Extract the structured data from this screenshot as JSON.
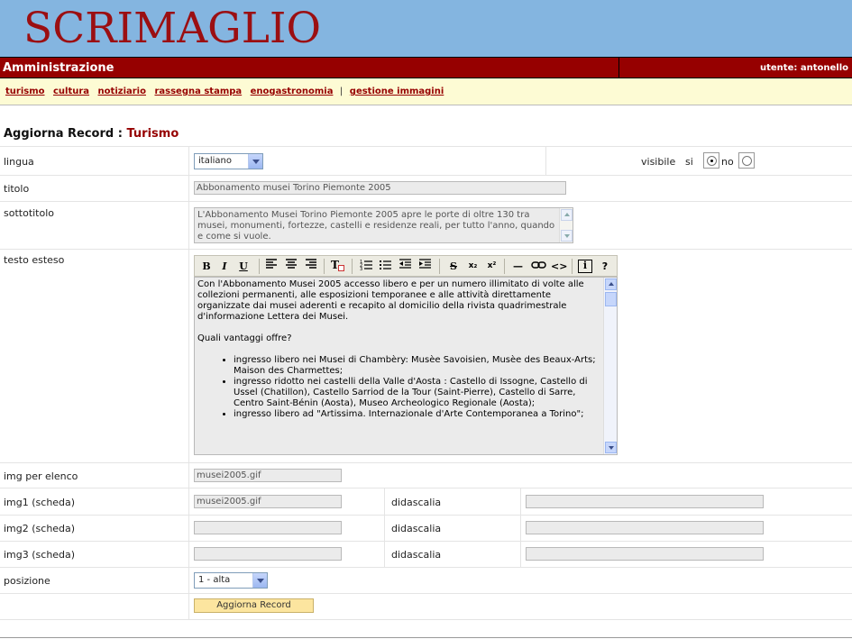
{
  "header": {
    "logo_text": "SCRIMAGLIO",
    "admin_title": "Amministrazione",
    "user_label": "utente: antonello"
  },
  "nav": {
    "links": [
      "turismo",
      "cultura",
      "notiziario",
      "rassegna stampa",
      "enogastronomia"
    ],
    "separator": "|",
    "extra_link": "gestione immagini"
  },
  "page": {
    "heading_prefix": "Aggiorna Record :",
    "heading_section": "Turismo"
  },
  "form": {
    "lingua": {
      "label": "lingua",
      "value": "italiano"
    },
    "visibile": {
      "label": "visibile",
      "option_si": "si",
      "option_no": "no",
      "selected": "si"
    },
    "titolo": {
      "label": "titolo",
      "value": "Abbonamento musei Torino Piemonte 2005"
    },
    "sottotitolo": {
      "label": "sottotitolo",
      "value": "L'Abbonamento Musei Torino Piemonte 2005 apre le porte di oltre 130 tra musei, monumenti, fortezze, castelli e residenze reali, per tutto l'anno, quando e come si vuole."
    },
    "testo_esteso": {
      "label": "testo esteso",
      "toolbar": {
        "bold": "B",
        "italic": "I",
        "underline": "U",
        "align_left": "align-left-icon",
        "align_center": "align-center-icon",
        "align_right": "align-right-icon",
        "clear_format": "clear-format-icon",
        "ordered_list": "ordered-list-icon",
        "unordered_list": "unordered-list-icon",
        "outdent": "outdent-icon",
        "indent": "indent-icon",
        "strike": "S",
        "subscript": "x₂",
        "superscript": "x²",
        "hr": "—",
        "link": "link-icon",
        "code": "<>",
        "info": "i",
        "help": "?"
      },
      "paragraph1": "Con l'Abbonamento Musei 2005 accesso libero e per un numero illimitato di volte alle collezioni permanenti, alle esposizioni temporanee e alle attività direttamente organizzate dai musei aderenti e recapito al domicilio della rivista quadrimestrale d'informazione Lettera dei Musei.",
      "paragraph2": "Quali vantaggi offre?",
      "bullets": [
        "ingresso libero nei Musei di Chambèry: Musèe Savoisien, Musèe des Beaux-Arts; Maison des Charmettes;",
        "ingresso ridotto nei castelli della Valle d'Aosta : Castello di Issogne, Castello di Ussel (Chatillon), Castello Sarriod de la Tour (Saint-Pierre), Castello di Sarre, Centro Saint-Bénin (Aosta), Museo Archeologico Regionale (Aosta);",
        "ingresso libero ad \"Artissima. Internazionale d'Arte Contemporanea a Torino\";"
      ]
    },
    "img_elenco": {
      "label": "img per elenco",
      "value": "musei2005.gif"
    },
    "img1": {
      "label": "img1 (scheda)",
      "value": "musei2005.gif",
      "didascalia_label": "didascalia",
      "didascalia_value": ""
    },
    "img2": {
      "label": "img2 (scheda)",
      "value": "",
      "didascalia_label": "didascalia",
      "didascalia_value": ""
    },
    "img3": {
      "label": "img3 (scheda)",
      "value": "",
      "didascalia_label": "didascalia",
      "didascalia_value": ""
    },
    "posizione": {
      "label": "posizione",
      "value": "1 - alta"
    },
    "submit_label": "Aggiorna Record"
  },
  "colors": {
    "banner_bg": "#84b5e0",
    "brand_red": "#960000",
    "nav_bg": "#fdfbd4",
    "button_bg": "#fce59f"
  }
}
